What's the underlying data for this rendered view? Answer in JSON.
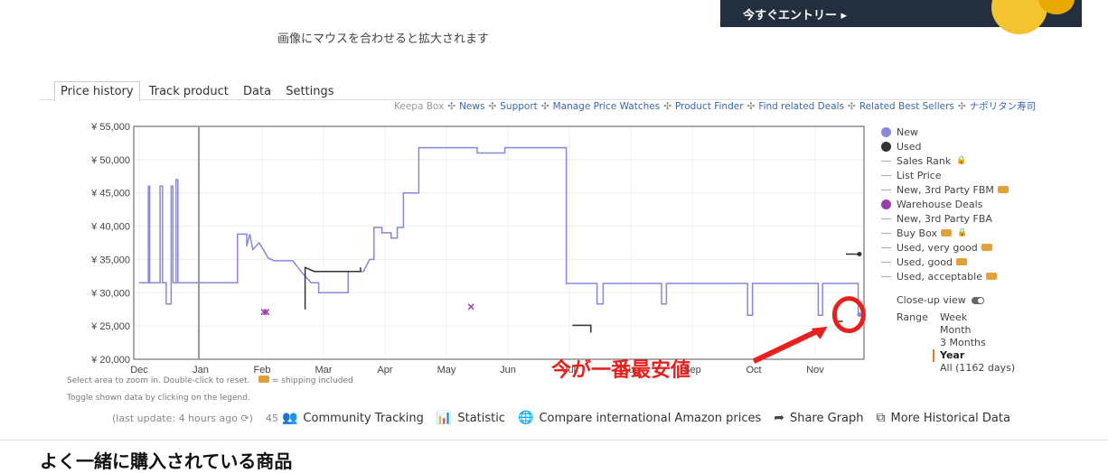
{
  "banner": {
    "cta": "今すぐエントリー ▸"
  },
  "zoom_hint": "画像にマウスを合わせると拡大されます",
  "tabs": [
    "Price history",
    "Track product",
    "Data",
    "Settings"
  ],
  "top_links": {
    "keepa_box": "Keepa Box",
    "links": [
      "News",
      "Support",
      "Manage Price Watches",
      "Product Finder",
      "Find related Deals",
      "Related Best Sellers",
      "ナポリタン寿司"
    ]
  },
  "chart_data": {
    "type": "line",
    "ylim": [
      20000,
      55000
    ],
    "y_ticks": [
      "¥ 20,000",
      "¥ 25,000",
      "¥ 30,000",
      "¥ 35,000",
      "¥ 40,000",
      "¥ 45,000",
      "¥ 50,000",
      "¥ 55,000"
    ],
    "x_ticks": [
      "Dec",
      "Jan",
      "Feb",
      "Mar",
      "Apr",
      "May",
      "Jun",
      "Jul",
      "Aug",
      "Sep",
      "Oct",
      "Nov"
    ],
    "series": [
      {
        "name": "New",
        "color": "#8888dd",
        "points": [
          [
            0.0,
            31500
          ],
          [
            0.15,
            31500
          ],
          [
            0.15,
            46000
          ],
          [
            0.17,
            46000
          ],
          [
            0.17,
            31500
          ],
          [
            0.34,
            31500
          ],
          [
            0.34,
            46000
          ],
          [
            0.38,
            46000
          ],
          [
            0.38,
            31500
          ],
          [
            0.44,
            31500
          ],
          [
            0.44,
            28300
          ],
          [
            0.52,
            28300
          ],
          [
            0.52,
            46000
          ],
          [
            0.55,
            46000
          ],
          [
            0.55,
            31500
          ],
          [
            0.6,
            31500
          ],
          [
            0.6,
            47000
          ],
          [
            0.63,
            47000
          ],
          [
            0.63,
            31500
          ],
          [
            1.6,
            31500
          ],
          [
            1.6,
            38800
          ],
          [
            1.75,
            38800
          ],
          [
            1.75,
            37000
          ],
          [
            1.8,
            38800
          ],
          [
            1.85,
            36500
          ],
          [
            1.95,
            37500
          ],
          [
            2.0,
            36800
          ],
          [
            2.1,
            35200
          ],
          [
            2.2,
            34800
          ],
          [
            2.5,
            34800
          ],
          [
            2.55,
            34200
          ],
          [
            2.65,
            33000
          ],
          [
            2.8,
            31500
          ],
          [
            2.92,
            31500
          ],
          [
            2.92,
            30000
          ],
          [
            3.4,
            30000
          ],
          [
            3.4,
            33200
          ],
          [
            3.65,
            33200
          ],
          [
            3.75,
            35000
          ],
          [
            3.82,
            35000
          ],
          [
            3.82,
            39800
          ],
          [
            3.95,
            39800
          ],
          [
            3.95,
            39000
          ],
          [
            4.1,
            39000
          ],
          [
            4.1,
            38200
          ],
          [
            4.2,
            38200
          ],
          [
            4.2,
            39800
          ],
          [
            4.3,
            39800
          ],
          [
            4.3,
            45000
          ],
          [
            4.55,
            45000
          ],
          [
            4.55,
            51800
          ],
          [
            5.5,
            51800
          ],
          [
            5.5,
            51000
          ],
          [
            5.95,
            51000
          ],
          [
            5.95,
            51800
          ],
          [
            6.95,
            51800
          ],
          [
            6.95,
            31400
          ],
          [
            7.45,
            31400
          ],
          [
            7.45,
            28300
          ],
          [
            7.55,
            28300
          ],
          [
            7.55,
            31400
          ],
          [
            8.5,
            31400
          ],
          [
            8.5,
            28300
          ],
          [
            8.58,
            28300
          ],
          [
            8.58,
            31400
          ],
          [
            9.9,
            31400
          ],
          [
            9.9,
            26600
          ],
          [
            9.98,
            26600
          ],
          [
            9.98,
            31400
          ],
          [
            11.05,
            31400
          ],
          [
            11.05,
            26600
          ],
          [
            11.12,
            26600
          ],
          [
            11.12,
            31400
          ],
          [
            11.7,
            31400
          ],
          [
            11.7,
            26700
          ],
          [
            11.72,
            26700
          ]
        ]
      },
      {
        "name": "Used",
        "color": "#333333",
        "segments": [
          [
            [
              2.7,
              27500
            ],
            [
              2.7,
              33800
            ],
            [
              2.85,
              33200
            ],
            [
              3.6,
              33200
            ],
            [
              3.6,
              33800
            ]
          ],
          [
            [
              7.05,
              25100
            ],
            [
              7.35,
              25100
            ],
            [
              7.35,
              24000
            ]
          ],
          [
            [
              11.3,
              25700
            ],
            [
              11.45,
              25700
            ]
          ],
          [
            [
              11.5,
              35800
            ],
            [
              11.72,
              35800
            ]
          ]
        ]
      },
      {
        "name": "Warehouse Deals",
        "color": "#9b3fb0",
        "markers": [
          [
            2.03,
            27100
          ],
          [
            2.07,
            27100
          ],
          [
            5.4,
            27900
          ]
        ]
      }
    ],
    "annotation": "今が一番最安値"
  },
  "legend": {
    "items": [
      {
        "label": "New",
        "kind": "dot",
        "color": "#8888dd"
      },
      {
        "label": "Used",
        "kind": "dot",
        "color": "#333333"
      },
      {
        "label": "Sales Rank",
        "kind": "dash",
        "extra": "lock"
      },
      {
        "label": "List Price",
        "kind": "dash"
      },
      {
        "label": "New, 3rd Party FBM",
        "kind": "dash",
        "extra": "truck"
      },
      {
        "label": "Warehouse Deals",
        "kind": "dot",
        "color": "#9b3fb0"
      },
      {
        "label": "New, 3rd Party FBA",
        "kind": "dash"
      },
      {
        "label": "Buy Box",
        "kind": "dash",
        "extra": "truck-lock"
      },
      {
        "label": "Used, very good",
        "kind": "dash",
        "extra": "truck"
      },
      {
        "label": "Used, good",
        "kind": "dash",
        "extra": "truck"
      },
      {
        "label": "Used, acceptable",
        "kind": "dash",
        "extra": "truck"
      }
    ],
    "closeup": "Close-up view",
    "range_label": "Range",
    "range_options": [
      "Week",
      "Month",
      "3 Months",
      "Year",
      "All (1162 days)"
    ],
    "range_selected": "Year"
  },
  "notes": {
    "line1": "Select area to zoom in. Double-click to reset.",
    "shipping": "= shipping included",
    "line2": "Toggle shown data by clicking on the legend."
  },
  "toolbar": {
    "last_update": "(last update: 4 hours ago",
    "tracking_count": "45",
    "community": "Community Tracking",
    "statistic": "Statistic",
    "compare": "Compare international Amazon prices",
    "share": "Share Graph",
    "history": "More Historical Data"
  },
  "section_title": "よく一緒に購入されている商品"
}
